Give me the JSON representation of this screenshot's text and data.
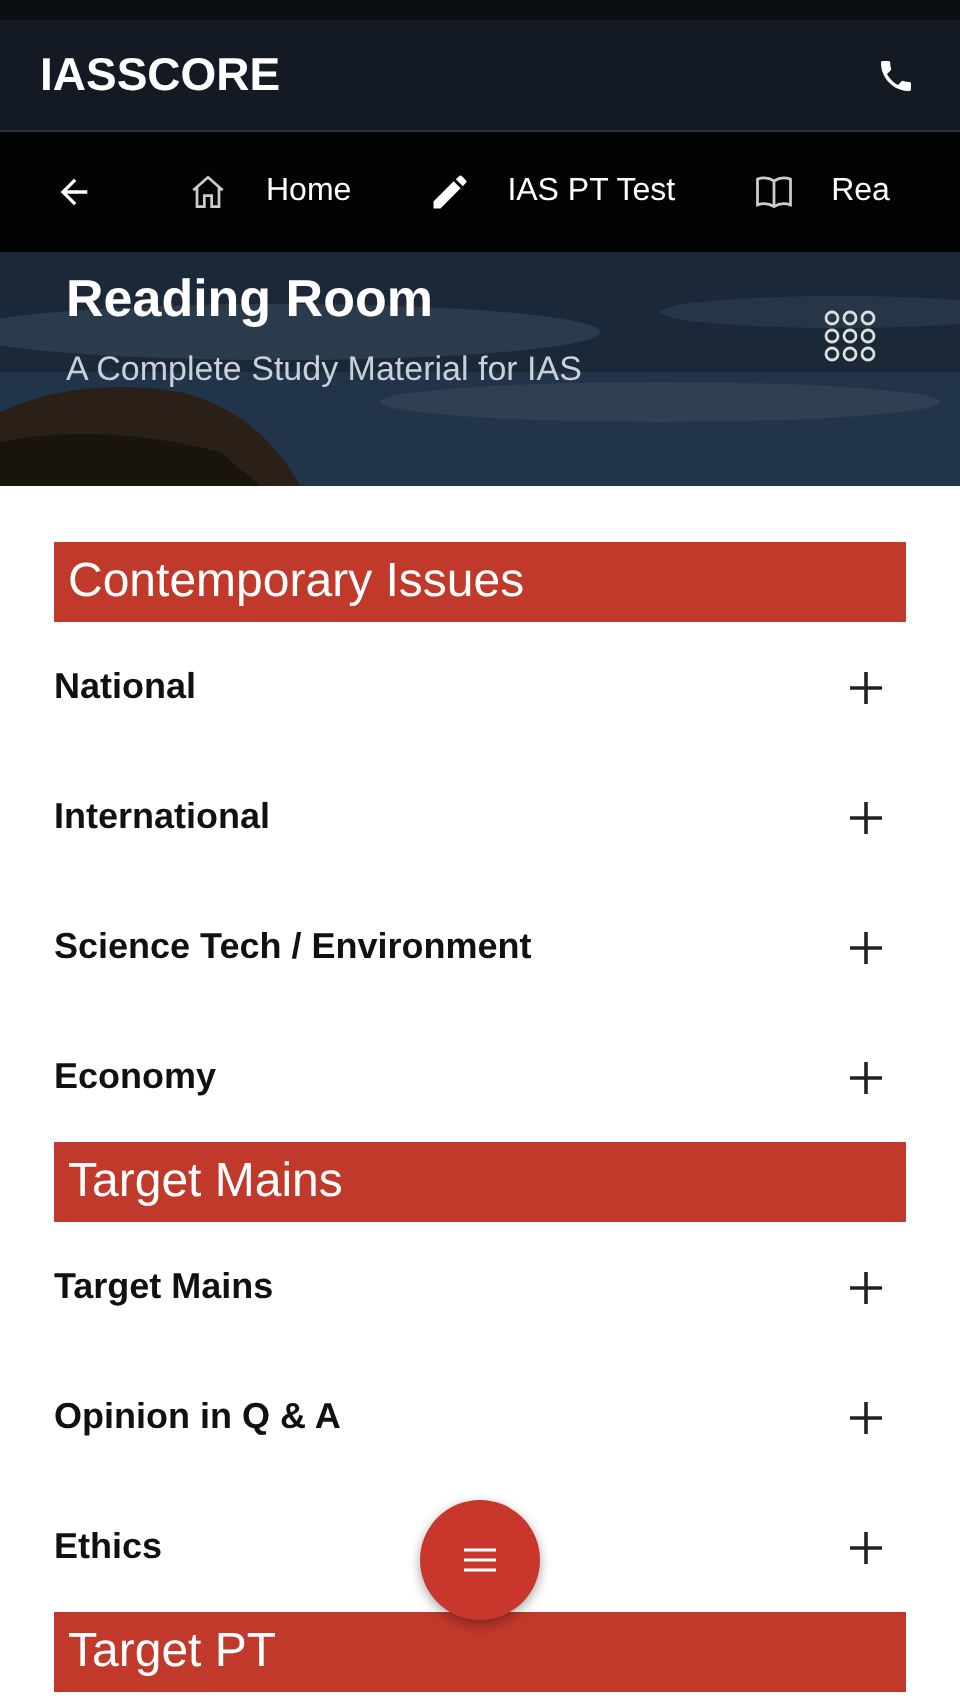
{
  "app_bar": {
    "title": "IASSCORE"
  },
  "nav": [
    {
      "label": "Home",
      "kind": "home",
      "selected": false
    },
    {
      "label": "IAS PT Test",
      "kind": "pencil",
      "selected": false
    },
    {
      "label": "Rea",
      "kind": "book",
      "selected": false
    }
  ],
  "hero": {
    "title": "Reading Room",
    "subtitle": "A Complete Study Material for IAS"
  },
  "sections": [
    {
      "title": "Contemporary Issues",
      "items": [
        {
          "label": "National",
          "expanded": false
        },
        {
          "label": "International",
          "expanded": false
        },
        {
          "label": "Science Tech / Environment",
          "expanded": false
        },
        {
          "label": "Economy",
          "expanded": false
        }
      ]
    },
    {
      "title": "Target Mains",
      "items": [
        {
          "label": "Target Mains",
          "expanded": false
        },
        {
          "label": "Opinion in Q & A",
          "expanded": false
        },
        {
          "label": "Ethics",
          "expanded": false
        }
      ]
    },
    {
      "title": "Target PT"
    }
  ]
}
